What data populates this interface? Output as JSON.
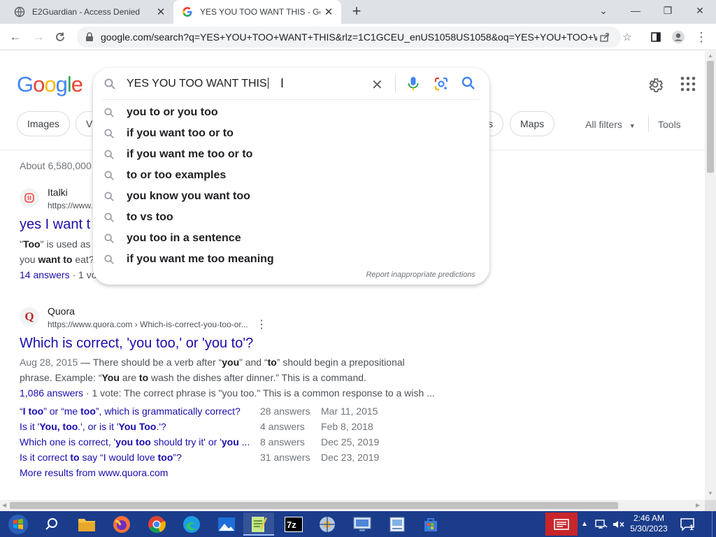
{
  "tabs": [
    {
      "title": "E2Guardian - Access Denied",
      "active": false
    },
    {
      "title": "YES YOU TOO WANT THIS - Goo",
      "active": true
    }
  ],
  "address_bar": {
    "url": "google.com/search?q=YES+YOU+TOO+WANT+THIS&rlz=1C1GCEU_enUS1058US1058&oq=YES+YOU+TOO+W..."
  },
  "google": {
    "logo_letters": [
      {
        "ch": "G",
        "color": "#4285f4"
      },
      {
        "ch": "o",
        "color": "#ea4335"
      },
      {
        "ch": "o",
        "color": "#fbbc05"
      },
      {
        "ch": "g",
        "color": "#4285f4"
      },
      {
        "ch": "l",
        "color": "#34a853"
      },
      {
        "ch": "e",
        "color": "#ea4335"
      }
    ],
    "search_query": "YES YOU TOO WANT THIS",
    "suggestions": [
      "you to or you too",
      "if you want too or to",
      "if you want me too or to",
      "to or too examples",
      "you know you want too",
      "to vs too",
      "you too in a sentence",
      "if you want me too meaning"
    ],
    "report_text": "Report inappropriate predictions",
    "filter_chips": {
      "images": "Images",
      "videos_partial": "Vi",
      "partial_right": "s",
      "maps": "Maps"
    },
    "all_filters": "All filters",
    "tools": "Tools",
    "about_results": "About 6,580,000"
  },
  "results": {
    "italki": {
      "site": "Italki",
      "url": "https://www.",
      "title": "yes I want t",
      "snippet_line1_prefix": "\"",
      "snippet_line1_bold": "Too",
      "snippet_line1_rest": "\" is used as",
      "snippet_line2_a": "you ",
      "snippet_line2_bold": "want to",
      "snippet_line2_b": " eat?",
      "answers": "14 answers",
      "votes_partial": "1 vo"
    },
    "quora": {
      "site": "Quora",
      "url": "https://www.quora.com › Which-is-correct-you-too-or...",
      "title": "Which is correct, 'you too,' or 'you to'?",
      "snippet_date": "Aug 28, 2015",
      "snippet_1a": " — There should be a verb after “",
      "snippet_1b": "you",
      "snippet_1c": "” and “",
      "snippet_1d": "to",
      "snippet_1e": "” should begin a prepositional",
      "snippet_2a": "phrase. Example: “",
      "snippet_2b": "You",
      "snippet_2c": " are ",
      "snippet_2d": "to",
      "snippet_2e": " wash the dishes after dinner.” This is a command.",
      "answers_count": "1,086 answers",
      "answers_rest": " · 1 vote: ",
      "answers_text": "The correct phrase is \"you too.\" This is a common response to a wish ...",
      "related": [
        {
          "q_html": "“<b>I too</b>” or “me <b>too</b>”, which is grammatically correct?",
          "answers": "28 answers",
          "date": "Mar 11, 2015"
        },
        {
          "q_html": "Is it '<b>You, too</b>.', or is it '<b>You Too</b>.'?",
          "answers": "4 answers",
          "date": "Feb 8, 2018"
        },
        {
          "q_html": "Which one is correct, '<b>you too</b> should try it' or '<b>you</b> ...",
          "answers": "8 answers",
          "date": "Dec 25, 2019"
        },
        {
          "q_html": "Is it correct <b>to</b> say “I would love <b>too</b>”?",
          "answers": "31 answers",
          "date": "Dec 23, 2019"
        }
      ],
      "more": "More results from www.quora.com"
    }
  },
  "taskbar": {
    "time": "2:46 AM",
    "date": "5/30/2023",
    "notification_count": "1",
    "apps": [
      "start",
      "search",
      "file-explorer",
      "firefox",
      "chrome",
      "edge",
      "photos",
      "notepad",
      "7zip",
      "network-tool",
      "remote-desktop",
      "image-viewer",
      "store"
    ]
  }
}
